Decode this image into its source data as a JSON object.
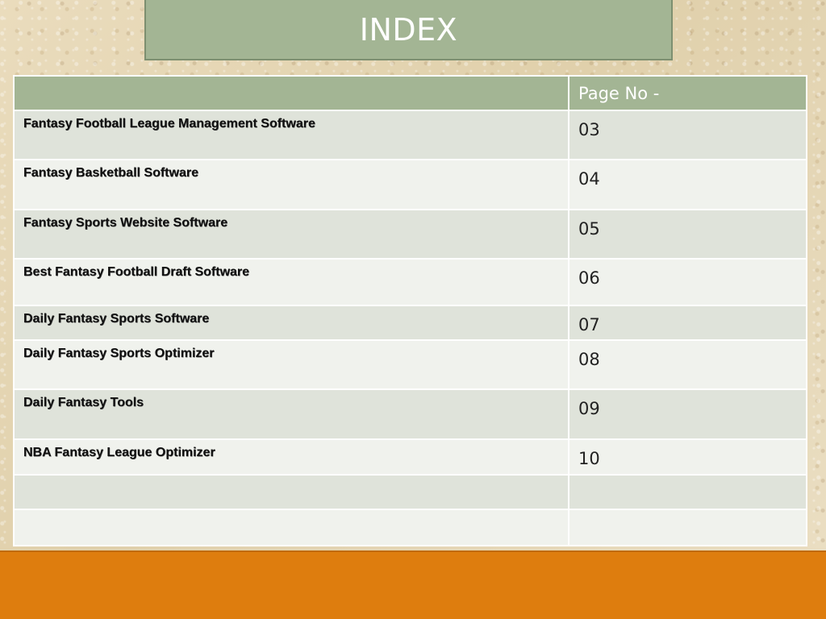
{
  "title": "INDEX",
  "table": {
    "header": {
      "title_col": "",
      "page_col": "Page No -"
    },
    "rows": [
      {
        "title": "Fantasy Football League Management Software",
        "page": "03"
      },
      {
        "title": "Fantasy Basketball Software",
        "page": "04"
      },
      {
        "title": "Fantasy Sports Website Software",
        "page": "05"
      },
      {
        "title": "Best Fantasy Football Draft Software",
        "page": "06"
      },
      {
        "title": "Daily Fantasy Sports Software",
        "page": "07"
      },
      {
        "title": "Daily Fantasy Sports Optimizer",
        "page": "08"
      },
      {
        "title": "Daily Fantasy Tools",
        "page": "09"
      },
      {
        "title": "NBA Fantasy League Optimizer",
        "page": "10"
      },
      {
        "title": "",
        "page": ""
      },
      {
        "title": "",
        "page": ""
      }
    ]
  },
  "colors": {
    "title_bg": "#a3b594",
    "bottom_bar": "#de7d0e",
    "row_odd": "#dfe3da",
    "row_even": "#f0f2ed"
  }
}
